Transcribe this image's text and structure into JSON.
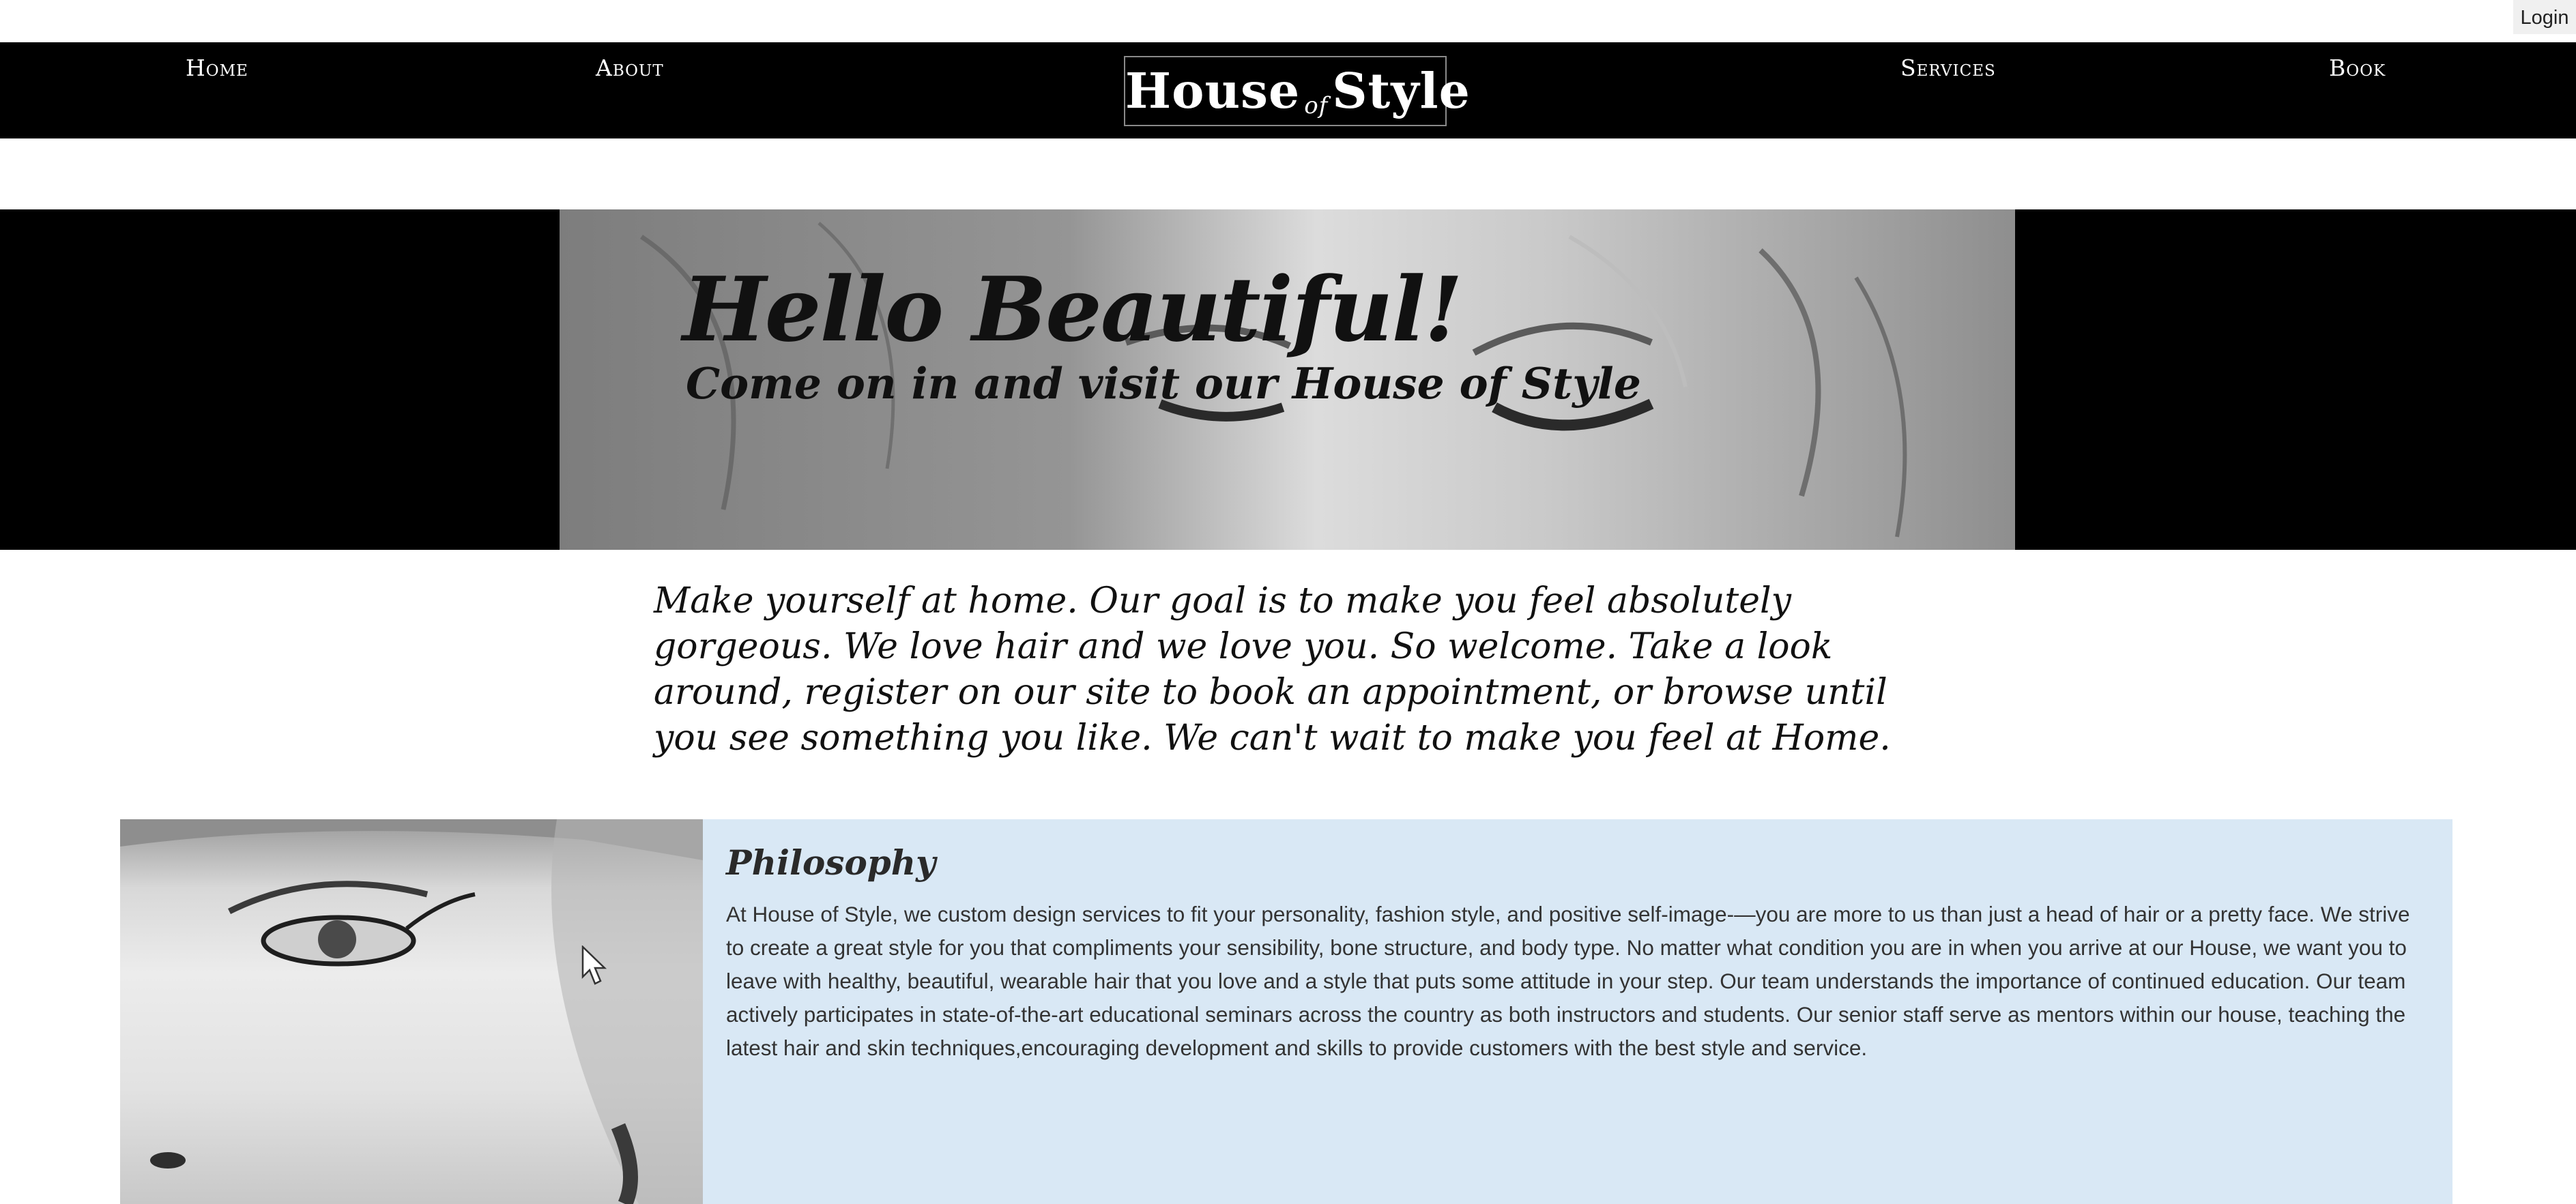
{
  "login_label": "Login",
  "nav": {
    "home": "Home",
    "about": "About",
    "services": "Services",
    "book": "Book"
  },
  "logo": {
    "word1": "House",
    "word2": "of",
    "word3": "Style"
  },
  "hero": {
    "title": "Hello Beautiful!",
    "subtitle": "Come on in and visit our House of Style"
  },
  "intro": "Make yourself at home. Our goal is to make you feel absolutely gorgeous. We love hair and we love you. So welcome. Take a look around, register on our site to book an appointment, or browse until you see something you like. We can't wait to make you feel at Home.",
  "philosophy": {
    "title": "Philosophy",
    "body": "At House of Style, we custom design services to fit your personality, fashion style, and positive self-image-—you are more to us than just a head of hair or a pretty face. We strive to create a great style for you that compliments your sensibility, bone structure, and body type. No matter what condition you are in when you arrive at our House, we want you to leave with healthy, beautiful, wearable hair that you love and a style that puts some attitude in your step. Our team understands the importance of continued education. Our team actively participates in state-of-the-art educational seminars across the country as both instructors and students. Our senior staff serve as mentors within our house, teaching the latest hair and skin techniques,encouraging development and skills to provide customers with the best style and service."
  },
  "colors": {
    "nav_bg": "#000000",
    "panel_bg": "#d9e8f5",
    "text": "#333333"
  }
}
